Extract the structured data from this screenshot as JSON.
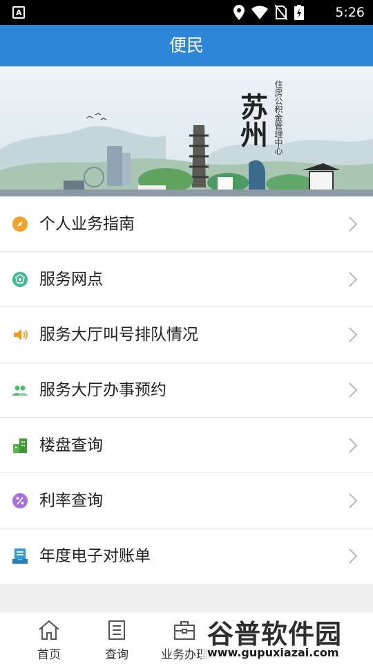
{
  "status_bar": {
    "time": "5:26",
    "app_glyph": "A"
  },
  "app_bar": {
    "title": "便民"
  },
  "banner": {
    "city_text": "苏州",
    "org_text": "住房公积金管理中心"
  },
  "menu": [
    {
      "label": "个人业务指南",
      "icon": "compass-icon",
      "color": "#f3a228"
    },
    {
      "label": "服务网点",
      "icon": "network-icon",
      "color": "#3dbd8e"
    },
    {
      "label": "服务大厅叫号排队情况",
      "icon": "speaker-icon",
      "color": "#f39a1e"
    },
    {
      "label": "服务大厅办事预约",
      "icon": "users-icon",
      "color": "#4aba6b"
    },
    {
      "label": "楼盘查询",
      "icon": "building-icon",
      "color": "#56b84a"
    },
    {
      "label": "利率查询",
      "icon": "percent-icon",
      "color": "#a66ee0"
    },
    {
      "label": "年度电子对账单",
      "icon": "statement-icon",
      "color": "#2d9bdc"
    }
  ],
  "tabs": [
    {
      "label": "首页",
      "icon": "home-icon"
    },
    {
      "label": "查询",
      "icon": "document-icon"
    },
    {
      "label": "业务办理",
      "icon": "briefcase-icon"
    }
  ],
  "watermark": {
    "main": "谷普软件园",
    "url": "www.gupuxiazai.com"
  },
  "colors": {
    "app_bar": "#2d86d8",
    "background": "#efefef"
  }
}
